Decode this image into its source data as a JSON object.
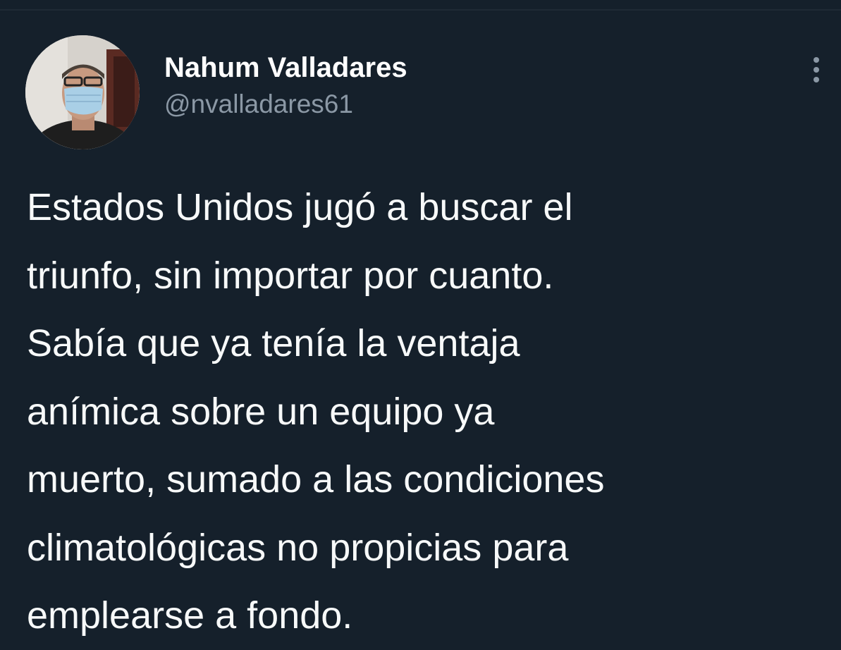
{
  "tweet": {
    "author": {
      "display_name": "Nahum Valladares",
      "handle": "@nvalladares61",
      "avatar_icon": "avatar-photo-icon"
    },
    "more_icon": "more-vertical-icon",
    "text": "Estados Unidos jugó a buscar el\ntriunfo, sin importar por cuanto.\nSabía que ya tenía la ventaja\nanímica sobre un equipo ya\nmuerto, sumado a las condiciones\nclimatológicas no propicias para\nemplearse a fondo."
  },
  "colors": {
    "background": "#15202b",
    "primary_text": "#f7f9f9",
    "secondary_text": "#8b98a5"
  }
}
